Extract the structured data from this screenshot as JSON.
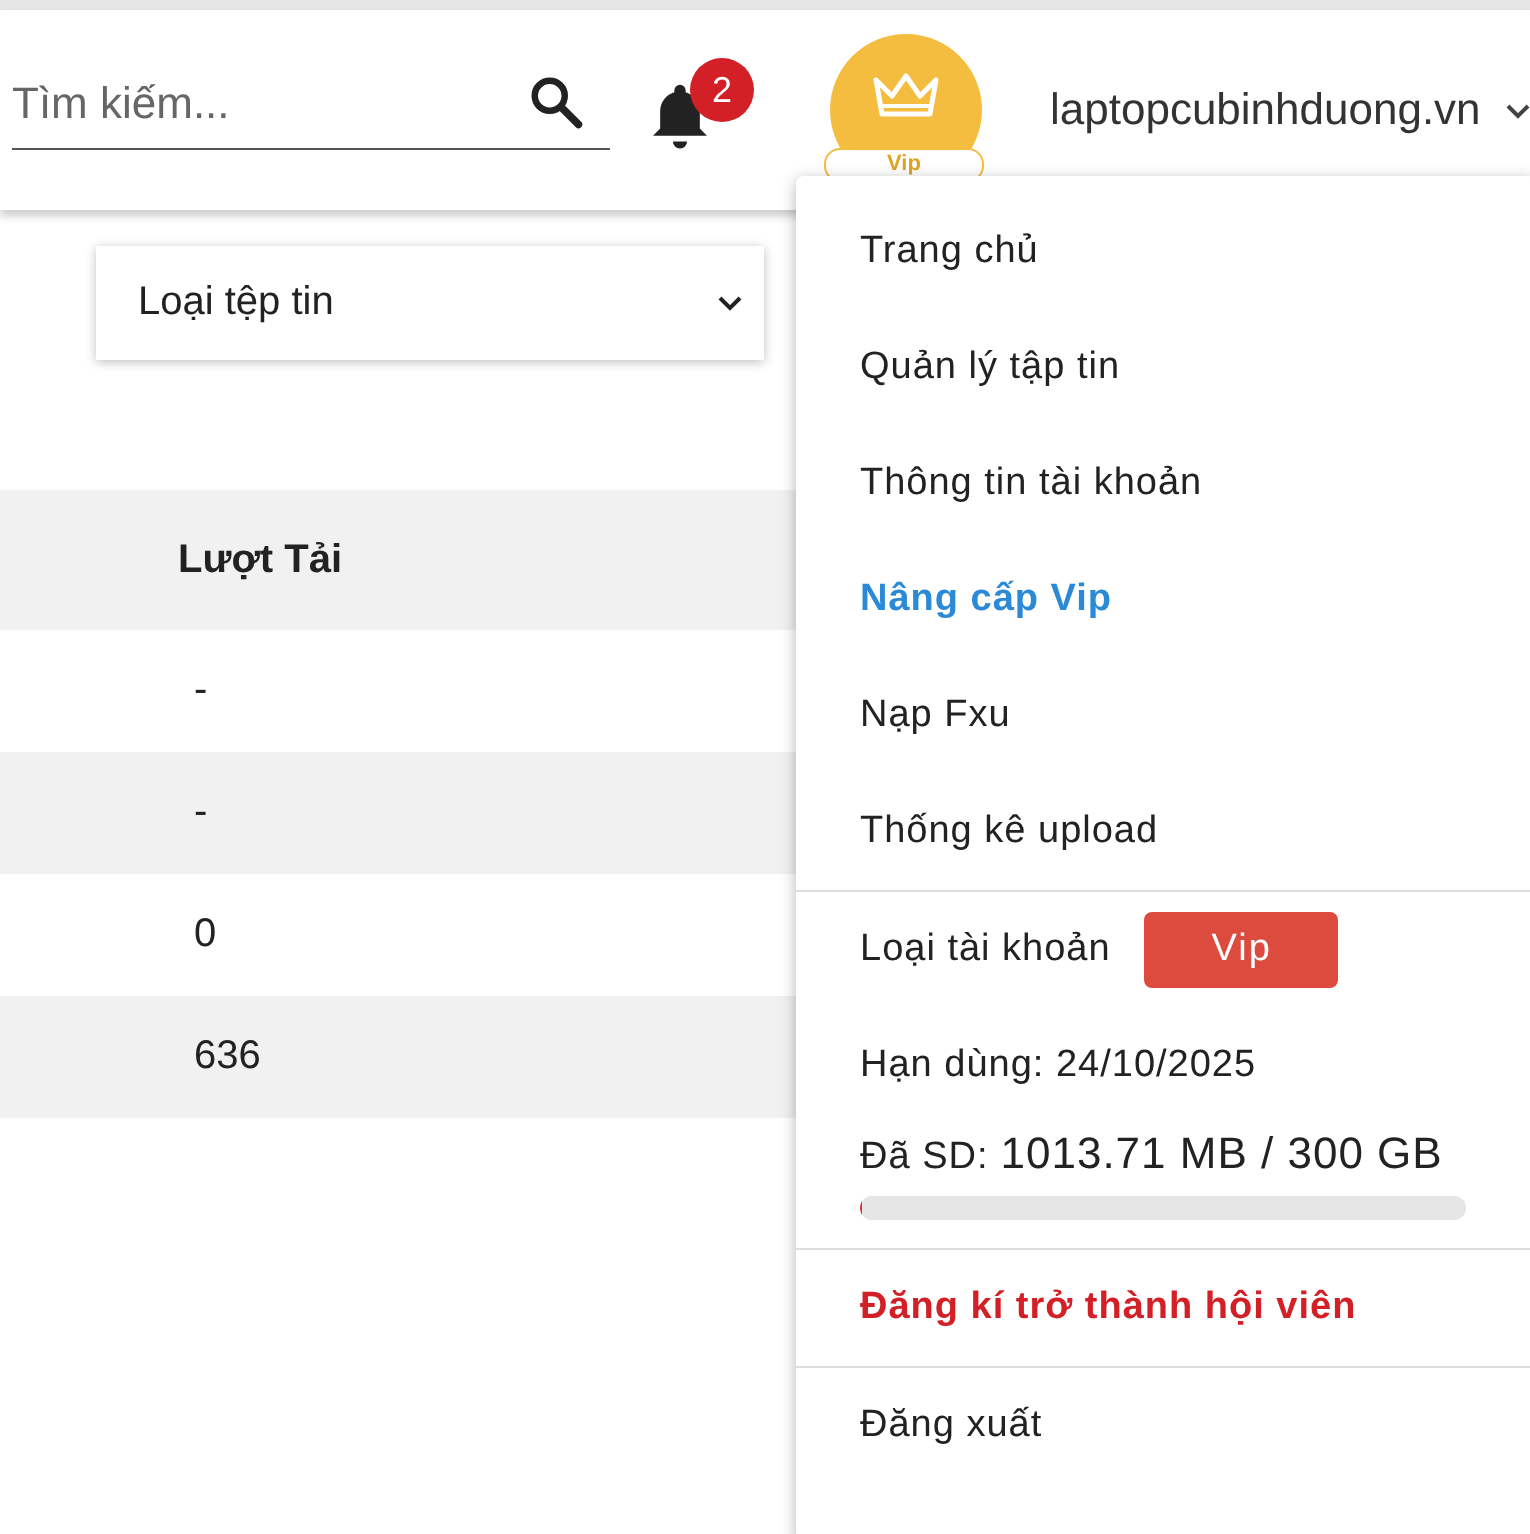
{
  "header": {
    "search": {
      "placeholder": "Tìm kiếm..."
    },
    "notifications": {
      "count": "2"
    },
    "vip_badge": {
      "label": "Vip"
    },
    "account": {
      "name": "laptopcubinhduong.vn"
    }
  },
  "filter": {
    "label": "Loại tệp tin"
  },
  "table": {
    "columns": [
      "Lượt Tải"
    ],
    "rows": [
      [
        "-"
      ],
      [
        "-"
      ],
      [
        "0"
      ],
      [
        "636"
      ]
    ]
  },
  "menu": {
    "items": [
      {
        "label": "Trang chủ",
        "selected": false
      },
      {
        "label": "Quản lý tập tin",
        "selected": false
      },
      {
        "label": "Thông tin tài khoản",
        "selected": false
      },
      {
        "label": "Nâng cấp Vip",
        "selected": true
      },
      {
        "label": "Nạp Fxu",
        "selected": false
      },
      {
        "label": "Thống kê upload",
        "selected": false
      }
    ],
    "account_type": {
      "label": "Loại tài khoản",
      "value": "Vip"
    },
    "expiry": "Hạn dùng: 24/10/2025",
    "usage": {
      "label": "Đã SD:",
      "value": "1013.71 MB / 300 GB",
      "level": 0.0033
    },
    "register": "Đăng kí trở thành hội viên",
    "logout": "Đăng xuất"
  }
}
